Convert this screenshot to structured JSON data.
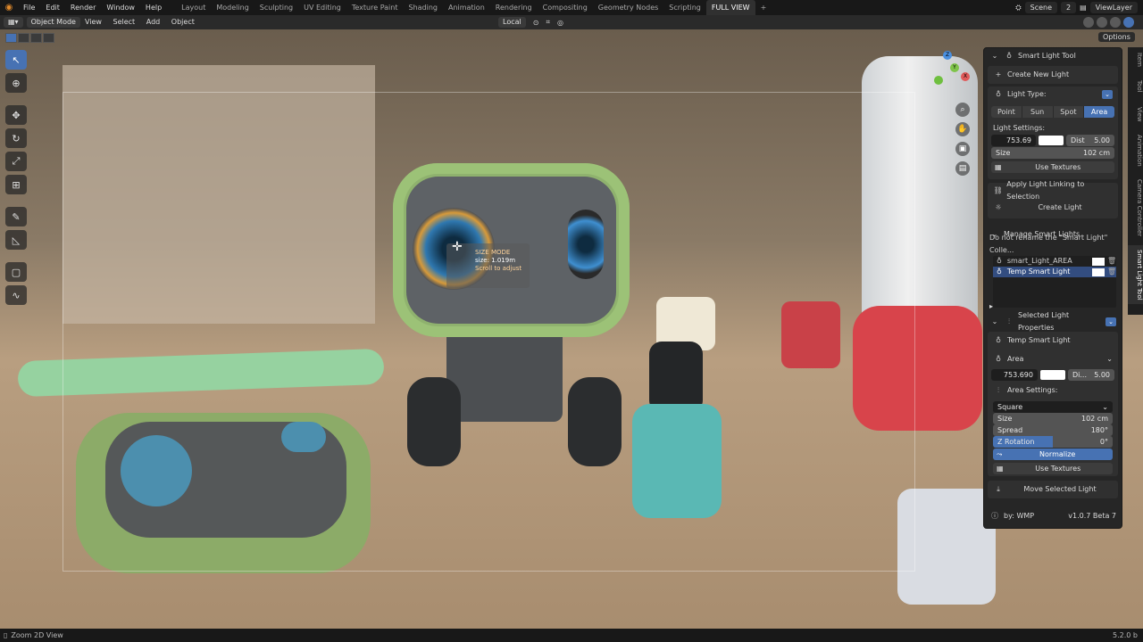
{
  "menu": [
    "File",
    "Edit",
    "Render",
    "Window",
    "Help"
  ],
  "workspaces": [
    "Layout",
    "Modeling",
    "Sculpting",
    "UV Editing",
    "Texture Paint",
    "Shading",
    "Animation",
    "Rendering",
    "Compositing",
    "Geometry Nodes",
    "Scripting",
    "FULL VIEW"
  ],
  "topright": {
    "scene": "Scene",
    "scene_count": "2",
    "view_layer": "ViewLayer"
  },
  "header": {
    "mode": "Object Mode",
    "menus": [
      "View",
      "Select",
      "Add",
      "Object"
    ],
    "transform_orientation": "Local",
    "options": "Options"
  },
  "overlay": {
    "line1": "SIZE MODE",
    "line2": "size: 1.019m",
    "line3": "Scroll to adjust"
  },
  "panel": {
    "title": "Smart Light Tool",
    "create_new_light": "Create New Light",
    "light_type_label": "Light Type:",
    "light_types": [
      "Point",
      "Sun",
      "Spot",
      "Area"
    ],
    "light_settings_label": "Light Settings:",
    "power_value": "753.69",
    "dist_label": "Dist",
    "dist_value": "5.00",
    "size_label": "Size",
    "size_value": "102 cm",
    "use_textures": "Use Textures",
    "apply_linking": "Apply Light Linking to Selection",
    "create_light": "Create Light",
    "manage_title": "Manage Smart Lights",
    "manage_warning": "Do not rename the \"Smart Light\" Colle...",
    "lights": [
      "smart_Light_AREA",
      "Temp Smart Light"
    ],
    "selected_props": "Selected Light Properties",
    "selected_name": "Temp Smart Light",
    "selected_type": "Area",
    "selected_power": "753.690",
    "selected_dist_label": "Di...",
    "selected_dist": "5.00",
    "area_settings": "Area Settings:",
    "shape": "Square",
    "area_size_label": "Size",
    "area_size": "102 cm",
    "spread_label": "Spread",
    "spread": "180°",
    "zrot_label": "Z Rotation",
    "zrot": "0°",
    "normalize": "Normalize",
    "use_textures2": "Use Textures",
    "move_selected": "Move Selected Light",
    "author": "by: WMP",
    "version": "v1.0.7 Beta 7"
  },
  "vtabs": [
    "Item",
    "Tool",
    "View",
    "Animation",
    "Camera Controller",
    "Smart Light Tool"
  ],
  "status": {
    "hint": "Zoom 2D View",
    "version": "5.2.0 b"
  },
  "colors": {
    "accent": "#4772b3",
    "panel": "#262626",
    "topbar": "#181818"
  }
}
